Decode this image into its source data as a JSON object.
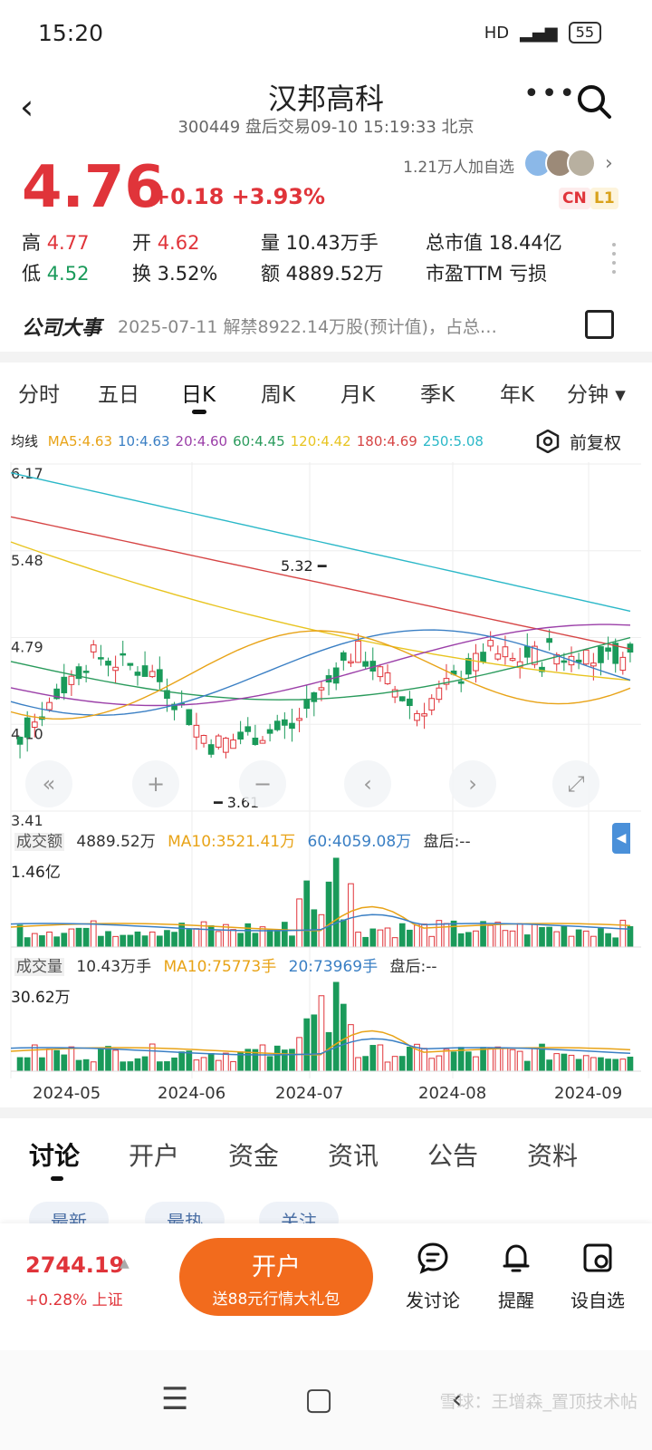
{
  "status_bar": {
    "time": "15:20",
    "signal": "HD",
    "battery": "55"
  },
  "header": {
    "title": "汉邦高科",
    "subtitle": "300449 盘后交易09-10 15:19:33 北京"
  },
  "quote": {
    "price": "4.76",
    "change": "+0.18 +3.93%",
    "watchers": "1.21万人加自选",
    "tags": [
      "CN",
      "L1"
    ],
    "high_label": "高",
    "high": "4.77",
    "open_label": "开",
    "open": "4.62",
    "volume": "量 10.43万手",
    "market_cap": "总市值 18.44亿",
    "low_label": "低",
    "low": "4.52",
    "turnover": "换 3.52%",
    "amount": "额 4889.52万",
    "pe": "市盈TTM 亏损"
  },
  "events": {
    "label": "公司大事",
    "text": "2025-07-11 解禁8922.14万股(预计值)，占总…"
  },
  "period_tabs": [
    "分时",
    "五日",
    "日K",
    "周K",
    "月K",
    "季K",
    "年K",
    "分钟 ▾"
  ],
  "ma_legend": {
    "label": "均线",
    "items": [
      {
        "text": "MA5:4.63",
        "color": "#e8a317"
      },
      {
        "text": "10:4.63",
        "color": "#3a7fc4"
      },
      {
        "text": "20:4.60",
        "color": "#9b3fa8"
      },
      {
        "text": "60:4.45",
        "color": "#2a9b5c"
      },
      {
        "text": "120:4.42",
        "color": "#e8c420"
      },
      {
        "text": "180:4.69",
        "color": "#d64545"
      },
      {
        "text": "250:5.08",
        "color": "#2bb8c8"
      }
    ],
    "adjust": "前复权"
  },
  "kchart": {
    "y_labels": [
      "6.17",
      "5.48",
      "4.79",
      "4.10",
      "3.41"
    ],
    "max_marker": "5.32",
    "min_marker": "3.61"
  },
  "amount_panel": {
    "label": "成交额",
    "value": "4889.52万",
    "ma10": "MA10:3521.41万",
    "ma60": "60:4059.08万",
    "after": "盘后:--",
    "top": "1.46亿"
  },
  "volume_panel": {
    "label": "成交量",
    "value": "10.43万手",
    "ma10": "MA10:75773手",
    "ma20": "20:73969手",
    "after": "盘后:--",
    "top": "30.62万"
  },
  "x_labels": [
    "2024-05",
    "2024-06",
    "2024-07",
    "2024-08",
    "2024-09"
  ],
  "discussion_tabs": [
    "讨论",
    "开户",
    "资金",
    "资讯",
    "公告",
    "资料"
  ],
  "pills": [
    "最新",
    "最热",
    "关注"
  ],
  "bottom_bar": {
    "index_value": "2744.19",
    "index_change": "+0.28% 上证",
    "open_account": "开户",
    "open_account_sub": "送88元行情大礼包",
    "actions": [
      "发讨论",
      "提醒",
      "设自选"
    ]
  },
  "watermark": "雪球：王增森_置顶技术帖",
  "chart_data": {
    "type": "candlestick",
    "x_ticks": [
      "2024-05",
      "2024-06",
      "2024-07",
      "2024-08",
      "2024-09"
    ],
    "y_ticks": [
      6.17,
      5.48,
      4.79,
      4.1,
      3.41
    ],
    "ylim": [
      3.41,
      6.17
    ],
    "annotations": [
      {
        "text": "5.32"
      },
      {
        "text": "3.61"
      }
    ],
    "moving_averages": [
      "MA5",
      "10",
      "20",
      "60",
      "120",
      "180",
      "250"
    ]
  }
}
